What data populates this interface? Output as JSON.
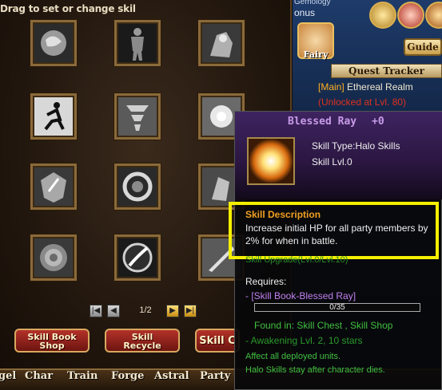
{
  "skill_panel": {
    "hint": "Drag to set or change skil",
    "page": "1/2",
    "buttons": {
      "skill_book_shop": "Skill Book\nShop",
      "skill_recycle": "Skill\nRecycle",
      "skill_partial": "Skill C"
    }
  },
  "right_ui": {
    "gemology": "Gemology",
    "bonus": "onus",
    "fairy": "Fairy",
    "guide": "Guide",
    "quest_tracker": "Quest Tracker",
    "quest_tag": "[Main]",
    "quest_name": " Ethereal Realm",
    "quest_locked": "(Unlocked at Lvl. 80)"
  },
  "bottom_nav": [
    "gel",
    "Char",
    "Train",
    "Forge",
    "Astral",
    "Party"
  ],
  "tooltip": {
    "title": "Blessed Ray",
    "level": "+0",
    "skill_type": "Skill Type:Halo Skills",
    "skill_level": "Skill Lvl.0",
    "description_title": "Skill Description",
    "description": "Increase initial HP for all party members by 2% for when in battle.",
    "upgrade": "Skill Upgrade(Lvl.0/Lvl.10)",
    "requires": "Requires:",
    "book": "- [Skill Book-Blessed Ray]",
    "book_progress_text": "0/35",
    "book_progress": 0.0,
    "found_in": "Found in: Skill Chest , Skill Shop",
    "awakening": "- Awakening Lvl. 2, 10 stars",
    "affect": "Affect all deployed units.",
    "stay": "Halo Skills stay after character dies."
  },
  "colors": {
    "highlight_box": "#f4f000",
    "tooltip_title": "#c89be8",
    "description_title": "#f0a020",
    "requirement_green": "#40c040"
  }
}
